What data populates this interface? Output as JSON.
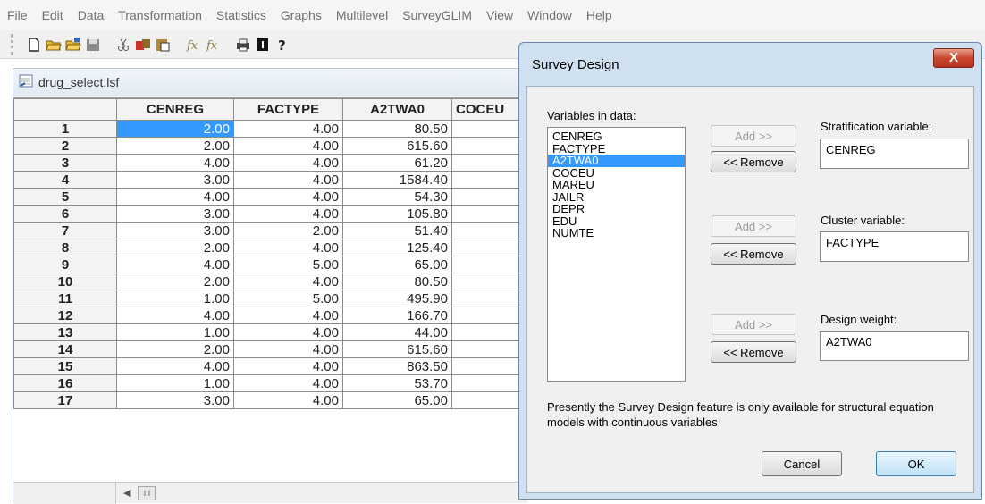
{
  "menu": [
    "File",
    "Edit",
    "Data",
    "Transformation",
    "Statistics",
    "Graphs",
    "Multilevel",
    "SurveyGLIM",
    "View",
    "Window",
    "Help"
  ],
  "toolbar": {
    "icons": [
      "new-file-icon",
      "open-icon",
      "open-data-icon",
      "save-icon",
      "cut-icon",
      "copy-icon",
      "paste-icon",
      "transform-icon",
      "transform2-icon",
      "print-icon",
      "info-icon",
      "help-icon"
    ]
  },
  "document": {
    "title": "drug_select.lsf",
    "columns": [
      "CENREG",
      "FACTYPE",
      "A2TWA0",
      "COCEU"
    ],
    "rows": [
      {
        "n": "1",
        "cenreg": "2.00",
        "factype": "4.00",
        "a2twa0": "80.50"
      },
      {
        "n": "2",
        "cenreg": "2.00",
        "factype": "4.00",
        "a2twa0": "615.60"
      },
      {
        "n": "3",
        "cenreg": "4.00",
        "factype": "4.00",
        "a2twa0": "61.20"
      },
      {
        "n": "4",
        "cenreg": "3.00",
        "factype": "4.00",
        "a2twa0": "1584.40"
      },
      {
        "n": "5",
        "cenreg": "4.00",
        "factype": "4.00",
        "a2twa0": "54.30"
      },
      {
        "n": "6",
        "cenreg": "3.00",
        "factype": "4.00",
        "a2twa0": "105.80"
      },
      {
        "n": "7",
        "cenreg": "3.00",
        "factype": "2.00",
        "a2twa0": "51.40"
      },
      {
        "n": "8",
        "cenreg": "2.00",
        "factype": "4.00",
        "a2twa0": "125.40"
      },
      {
        "n": "9",
        "cenreg": "4.00",
        "factype": "5.00",
        "a2twa0": "65.00"
      },
      {
        "n": "10",
        "cenreg": "2.00",
        "factype": "4.00",
        "a2twa0": "80.50"
      },
      {
        "n": "11",
        "cenreg": "1.00",
        "factype": "5.00",
        "a2twa0": "495.90"
      },
      {
        "n": "12",
        "cenreg": "4.00",
        "factype": "4.00",
        "a2twa0": "166.70"
      },
      {
        "n": "13",
        "cenreg": "1.00",
        "factype": "4.00",
        "a2twa0": "44.00"
      },
      {
        "n": "14",
        "cenreg": "2.00",
        "factype": "4.00",
        "a2twa0": "615.60"
      },
      {
        "n": "15",
        "cenreg": "4.00",
        "factype": "4.00",
        "a2twa0": "863.50"
      },
      {
        "n": "16",
        "cenreg": "1.00",
        "factype": "4.00",
        "a2twa0": "53.70"
      },
      {
        "n": "17",
        "cenreg": "3.00",
        "factype": "4.00",
        "a2twa0": "65.00"
      }
    ],
    "scroll_thumb": "III"
  },
  "dialog": {
    "title": "Survey Design",
    "close_label": "X",
    "variables_label": "Variables in data:",
    "variables": [
      "CENREG",
      "FACTYPE",
      "A2TWA0",
      "COCEU",
      "MAREU",
      "JAILR",
      "DEPR",
      "EDU",
      "NUMTE"
    ],
    "selected_variable": "A2TWA0",
    "add_label": "Add >>",
    "remove_label": "<< Remove",
    "strat_label": "Stratification variable:",
    "strat_value": "CENREG",
    "cluster_label": "Cluster variable:",
    "cluster_value": "FACTYPE",
    "weight_label": "Design weight:",
    "weight_value": "A2TWA0",
    "note": "Presently the Survey Design feature is only available for structural equation models with continuous variables",
    "cancel_label": "Cancel",
    "ok_label": "OK"
  }
}
